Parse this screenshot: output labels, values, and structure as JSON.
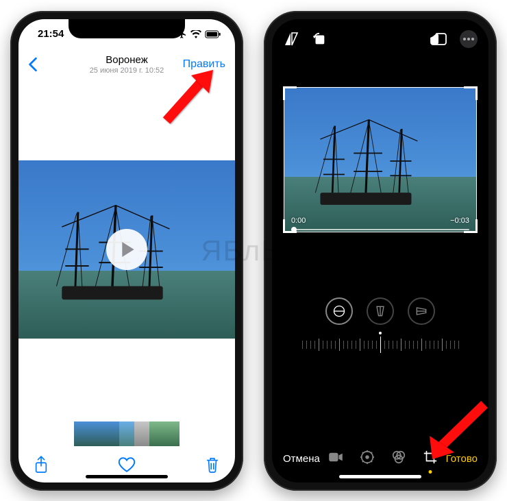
{
  "watermark": "ЯБлЫК",
  "left": {
    "status_time": "21:54",
    "header": {
      "back_label": "",
      "location": "Воронеж",
      "date": "25 июня 2019 г.  10:52",
      "edit_label": "Править"
    }
  },
  "right": {
    "timeline": {
      "current": "0:00",
      "remaining": "−0:03"
    },
    "bottom": {
      "cancel": "Отмена",
      "done": "Готово"
    }
  },
  "colors": {
    "ios_blue": "#007aff",
    "ios_yellow": "#ffcc00",
    "arrow_red": "#ff0a0a"
  }
}
